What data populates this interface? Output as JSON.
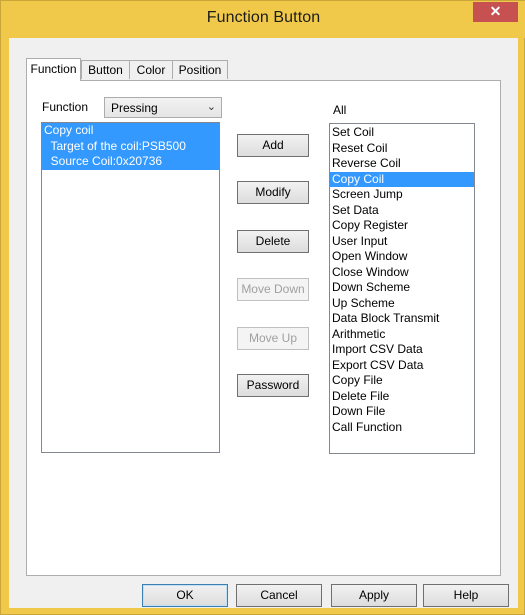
{
  "window": {
    "title": "Function Button",
    "close_glyph": "✕"
  },
  "tabs": [
    {
      "label": "Function",
      "active": true
    },
    {
      "label": "Button",
      "active": false
    },
    {
      "label": "Color",
      "active": false
    },
    {
      "label": "Position",
      "active": false
    }
  ],
  "function_panel": {
    "function_label": "Function",
    "mode_value": "Pressing",
    "configured_list": [
      {
        "text": "Copy coil",
        "selected": true
      },
      {
        "text": "  Target of the coil:PSB500",
        "selected": true
      },
      {
        "text": "  Source Coil:0x20736",
        "selected": true
      }
    ],
    "buttons": {
      "add": "Add",
      "modify": "Modify",
      "delete": "Delete",
      "move_down": "Move Down",
      "move_up": "Move Up",
      "password": "Password"
    },
    "all_label": "All",
    "all_functions": [
      "Set Coil",
      "Reset Coil",
      "Reverse Coil",
      "Copy Coil",
      "Screen Jump",
      "Set Data",
      "Copy Register",
      "User Input",
      "Open Window",
      "Close Window",
      "Down Scheme",
      "Up Scheme",
      "Data Block Transmit",
      "Arithmetic",
      "Import CSV Data",
      "Export CSV Data",
      "Copy File",
      "Delete File",
      "Down File",
      "Call Function"
    ],
    "all_selected": "Copy Coil"
  },
  "dialog_buttons": {
    "ok": "OK",
    "cancel": "Cancel",
    "apply": "Apply",
    "help": "Help"
  },
  "colors": {
    "titlebar": "#f0c94a",
    "selection": "#3399ff",
    "close": "#c75050"
  }
}
